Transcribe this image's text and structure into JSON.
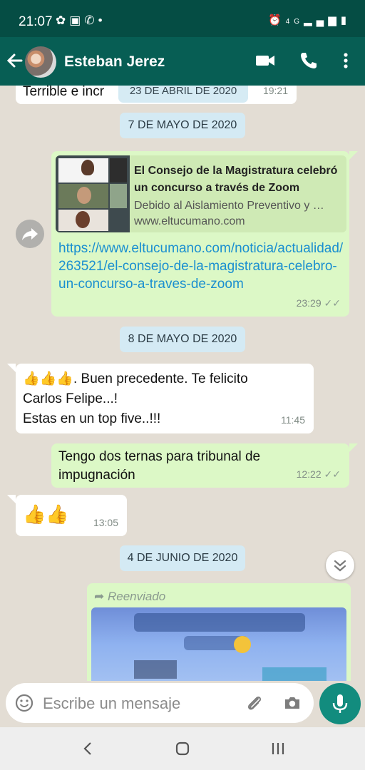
{
  "status_bar": {
    "time": "21:07",
    "network": "4G"
  },
  "header": {
    "contact_name": "Esteban Jerez"
  },
  "chat": {
    "partial_message": {
      "text": "Terrible e incr",
      "time": "19:21"
    },
    "date_chip_top": "23 DE ABRIL DE 2020",
    "date_1": "7 DE MAYO DE 2020",
    "link_message": {
      "preview_title": "El Consejo de la Magistratura celebró un concurso a través de Zoom",
      "preview_description": "Debido al Aislamiento Preventivo y …",
      "preview_site": "www.eltucumano.com",
      "url": "https://www.eltucumano.com/noticia/actualidad/263521/el-consejo-de-la-magistratura-celebro-un-concurso-a-traves-de-zoom",
      "time": "23:29"
    },
    "date_2": "8 DE MAYO DE 2020",
    "msg_felicito": {
      "emojis": "👍👍👍",
      "line1": ".  Buen precedente.  Te felicito",
      "line2": "Carlos Felipe...!",
      "line3": "Estas en un top five..!!!",
      "time": "11:45"
    },
    "msg_ternas": {
      "line1": "Tengo dos ternas para tribunal de",
      "line2": "impugnación",
      "time": "12:22"
    },
    "msg_thumbs": {
      "emojis": "👍👍",
      "time": "13:05"
    },
    "date_3": "4 DE JUNIO DE 2020",
    "forwarded": {
      "label": "Reenviado"
    }
  },
  "input": {
    "placeholder": "Escribe un mensaje"
  },
  "colors": {
    "header": "#075e54",
    "status_bar": "#054d44",
    "outgoing": "#dcf8c6",
    "incoming": "#ffffff",
    "link": "#1a8fd0",
    "accent": "#128c7e"
  }
}
